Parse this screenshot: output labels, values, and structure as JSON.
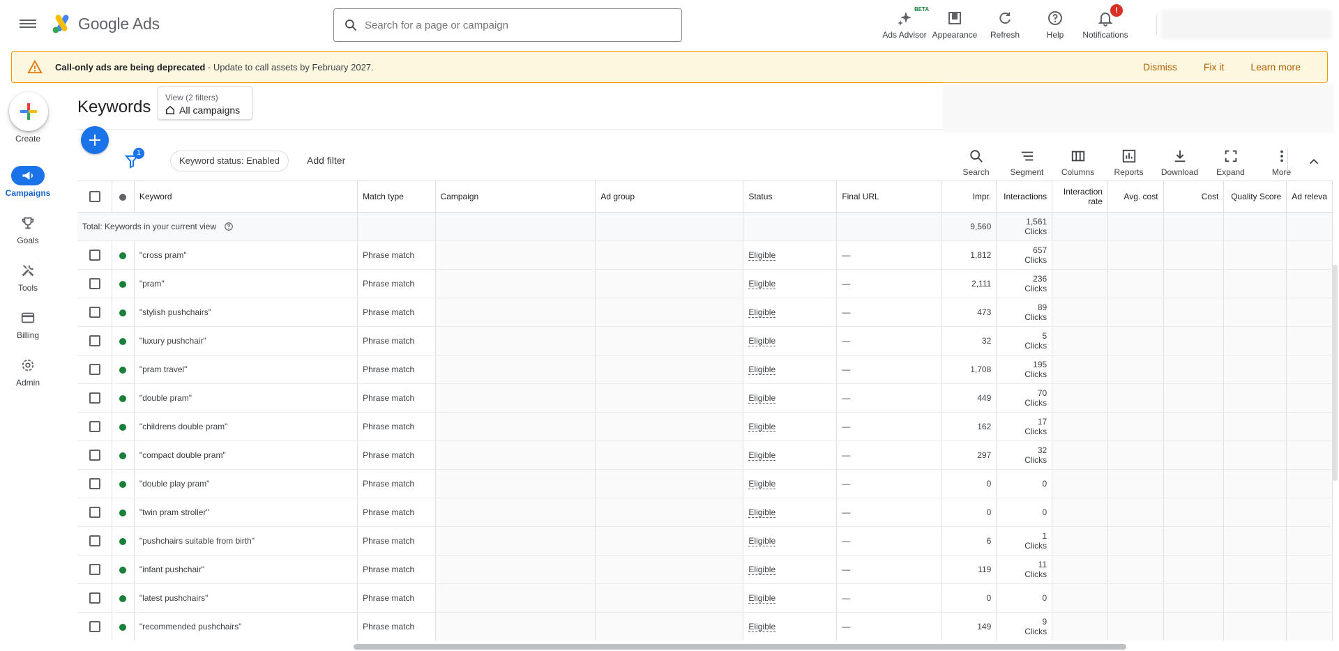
{
  "app": {
    "logo_text": "Google Ads"
  },
  "search": {
    "placeholder": "Search for a page or campaign"
  },
  "top_actions": [
    {
      "label": "Ads Advisor",
      "badge": "BETA",
      "icon": "sparkle-icon"
    },
    {
      "label": "Appearance",
      "icon": "appearance-icon"
    },
    {
      "label": "Refresh",
      "icon": "refresh-icon"
    },
    {
      "label": "Help",
      "icon": "help-icon"
    },
    {
      "label": "Notifications",
      "badge": "!",
      "icon": "bell-icon"
    }
  ],
  "banner": {
    "title": "Call-only ads are being deprecated",
    "message": " - Update to call assets by February 2027.",
    "actions": [
      "Dismiss",
      "Fix it",
      "Learn more"
    ]
  },
  "sidenav": {
    "create_label": "Create",
    "items": [
      {
        "label": "Campaigns",
        "active": true
      },
      {
        "label": "Goals"
      },
      {
        "label": "Tools"
      },
      {
        "label": "Billing"
      },
      {
        "label": "Admin"
      }
    ]
  },
  "page": {
    "title": "Keywords",
    "view_sub": "View (2 filters)",
    "view_main": "All campaigns"
  },
  "toolbar": {
    "filter_count": "1",
    "chip": "Keyword status: Enabled",
    "add_filter": "Add filter",
    "tools": [
      "Search",
      "Segment",
      "Columns",
      "Reports",
      "Download",
      "Expand",
      "More"
    ]
  },
  "table": {
    "headers": {
      "keyword": "Keyword",
      "match_type": "Match type",
      "campaign": "Campaign",
      "ad_group": "Ad group",
      "status": "Status",
      "final_url": "Final URL",
      "impr": "Impr.",
      "interactions": "Interactions",
      "interaction_rate": "Interaction rate",
      "avg_cost": "Avg. cost",
      "cost": "Cost",
      "quality_score": "Quality Score",
      "ad_relevance": "Ad releva"
    },
    "total": {
      "label": "Total: Keywords in your current view",
      "impr": "9,560",
      "interactions_value": "1,561",
      "interactions_unit": "Clicks"
    },
    "rows": [
      {
        "keyword": "\"cross pram\"",
        "match": "Phrase match",
        "status": "Eligible",
        "url": "—",
        "impr": "1,812",
        "int": "657",
        "unit": "Clicks"
      },
      {
        "keyword": "\"pram\"",
        "match": "Phrase match",
        "status": "Eligible",
        "url": "—",
        "impr": "2,111",
        "int": "236",
        "unit": "Clicks"
      },
      {
        "keyword": "\"stylish pushchairs\"",
        "match": "Phrase match",
        "status": "Eligible",
        "url": "—",
        "impr": "473",
        "int": "89",
        "unit": "Clicks"
      },
      {
        "keyword": "\"luxury pushchair\"",
        "match": "Phrase match",
        "status": "Eligible",
        "url": "—",
        "impr": "32",
        "int": "5",
        "unit": "Clicks"
      },
      {
        "keyword": "\"pram travel\"",
        "match": "Phrase match",
        "status": "Eligible",
        "url": "—",
        "impr": "1,708",
        "int": "195",
        "unit": "Clicks"
      },
      {
        "keyword": "\"double pram\"",
        "match": "Phrase match",
        "status": "Eligible",
        "url": "—",
        "impr": "449",
        "int": "70",
        "unit": "Clicks"
      },
      {
        "keyword": "\"childrens double pram\"",
        "match": "Phrase match",
        "status": "Eligible",
        "url": "—",
        "impr": "162",
        "int": "17",
        "unit": "Clicks"
      },
      {
        "keyword": "\"compact double pram\"",
        "match": "Phrase match",
        "status": "Eligible",
        "url": "—",
        "impr": "297",
        "int": "32",
        "unit": "Clicks"
      },
      {
        "keyword": "\"double play pram\"",
        "match": "Phrase match",
        "status": "Eligible",
        "url": "—",
        "impr": "0",
        "int": "0",
        "unit": ""
      },
      {
        "keyword": "\"twin pram stroller\"",
        "match": "Phrase match",
        "status": "Eligible",
        "url": "—",
        "impr": "0",
        "int": "0",
        "unit": ""
      },
      {
        "keyword": "\"pushchairs suitable from birth\"",
        "match": "Phrase match",
        "status": "Eligible",
        "url": "—",
        "impr": "6",
        "int": "1",
        "unit": "Clicks"
      },
      {
        "keyword": "\"infant pushchair\"",
        "match": "Phrase match",
        "status": "Eligible",
        "url": "—",
        "impr": "119",
        "int": "11",
        "unit": "Clicks"
      },
      {
        "keyword": "\"latest pushchairs\"",
        "match": "Phrase match",
        "status": "Eligible",
        "url": "—",
        "impr": "0",
        "int": "0",
        "unit": ""
      },
      {
        "keyword": "\"recommended pushchairs\"",
        "match": "Phrase match",
        "status": "Eligible",
        "url": "—",
        "impr": "149",
        "int": "9",
        "unit": "Clicks"
      }
    ]
  },
  "colors": {
    "accent": "#1a73e8",
    "enabled": "#188038",
    "warning": "#f29900",
    "link": "#b06000"
  }
}
